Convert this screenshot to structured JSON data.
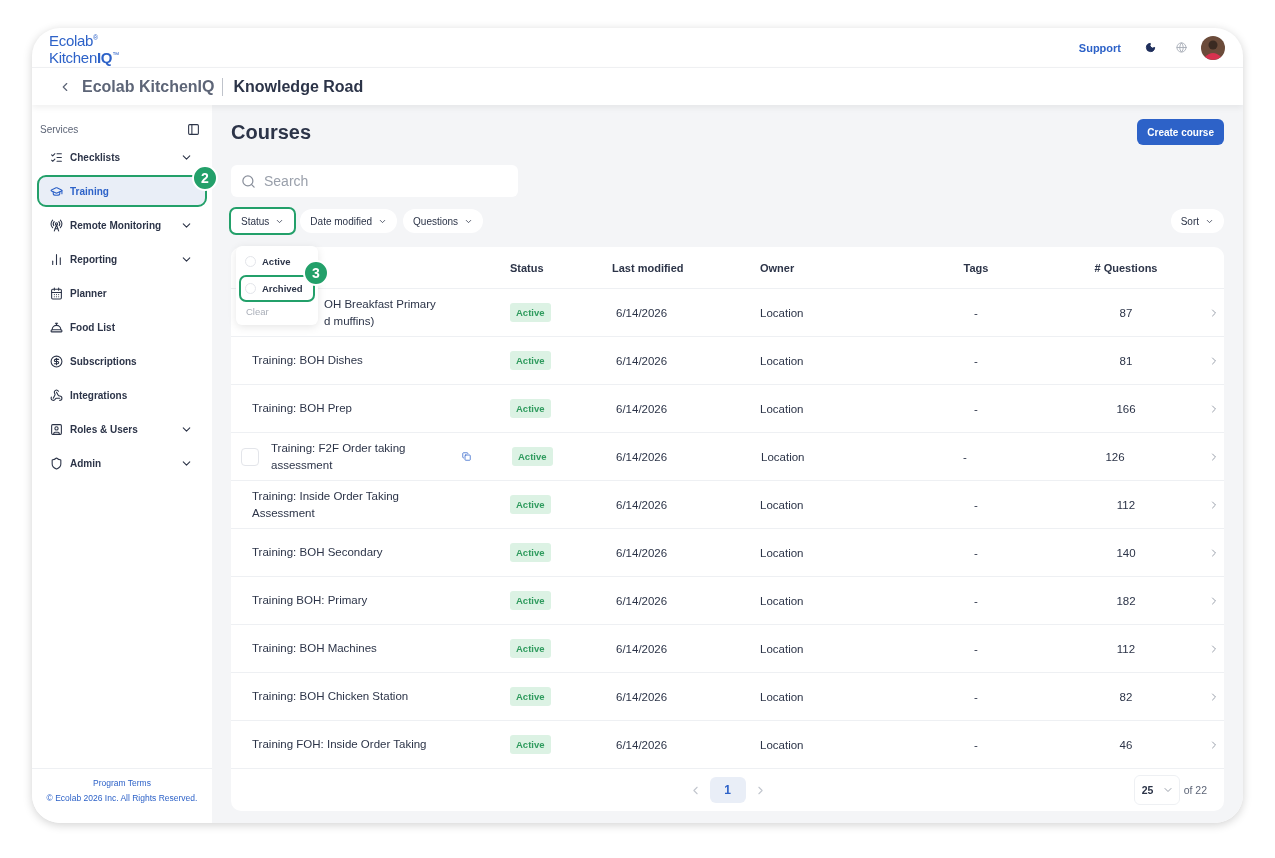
{
  "header": {
    "logo_line_1": "Ecolab$^{®}$",
    "logo_line_2": "Kitchen**IQ**$^{™}$",
    "support_link": "Support"
  },
  "breadcrumb": {
    "parent": "Ecolab KitchenIQ",
    "current": "Knowledge Road"
  },
  "sidebar": {
    "section_label": "Services",
    "items": [
      {
        "label": "Checklists",
        "expandable": true,
        "selected": false,
        "highlighted": false
      },
      {
        "label": "Training",
        "expandable": false,
        "selected": true,
        "highlighted": true,
        "callout": "2"
      },
      {
        "label": "Remote Monitoring",
        "expandable": true,
        "selected": false,
        "highlighted": false
      },
      {
        "label": "Reporting",
        "expandable": true,
        "selected": false,
        "highlighted": false
      },
      {
        "label": "Planner",
        "expandable": false,
        "selected": false,
        "highlighted": false
      },
      {
        "label": "Food List",
        "expandable": false,
        "selected": false,
        "highlighted": false
      },
      {
        "label": "Subscriptions",
        "expandable": false,
        "selected": false,
        "highlighted": false
      },
      {
        "label": "Integrations",
        "expandable": false,
        "selected": false,
        "highlighted": false
      },
      {
        "label": "Roles & Users",
        "expandable": true,
        "selected": false,
        "highlighted": false
      },
      {
        "label": "Admin",
        "expandable": true,
        "selected": false,
        "highlighted": false
      }
    ],
    "footer_link": "Program Terms",
    "copyright": "© Ecolab 2026 Inc. All Rights Reserved."
  },
  "page_title": "Courses",
  "create_button": "Create course",
  "search": {
    "placeholder": "Search"
  },
  "filters": [
    {
      "label": "Status",
      "highlighted": true
    },
    {
      "label": "Date modified",
      "highlighted": false
    },
    {
      "label": "Questions",
      "highlighted": false
    }
  ],
  "sort_button": "Sort",
  "status_menu": {
    "options": [
      {
        "label": "Active",
        "selected": false,
        "highlighted": false
      },
      {
        "label": "Archived",
        "selected": false,
        "highlighted": true,
        "callout": "3"
      }
    ],
    "clear": "Clear",
    "clear_disabled": true
  },
  "table": {
    "columns": [
      "Status",
      "Last modified",
      "Owner",
      "Tags",
      "# Questions"
    ],
    "rows": [
      {
        "kind": "partly_hidden",
        "name": "OH Breakfast Primary\nd muffins)",
        "status": "Active",
        "modified": "6/14/2026",
        "owner": "Location",
        "tags": "-",
        "questions": "87"
      },
      {
        "kind": "plain",
        "name": "Training: BOH Dishes",
        "status": "Active",
        "modified": "6/14/2026",
        "owner": "Location",
        "tags": "-",
        "questions": "81"
      },
      {
        "kind": "plain",
        "name": "Training:  BOH Prep",
        "status": "Active",
        "modified": "6/14/2026",
        "owner": "Location",
        "tags": "-",
        "questions": "166"
      },
      {
        "kind": "hover",
        "checked": false,
        "name": "Training: F2F Order taking\nassessment",
        "status": "Active",
        "modified": "6/14/2026",
        "owner": "Location",
        "tags": "-",
        "questions": "126"
      },
      {
        "kind": "plain",
        "name": "Training: Inside Order Taking\nAssessment",
        "status": "Active",
        "modified": "6/14/2026",
        "owner": "Location",
        "tags": "-",
        "questions": "112"
      },
      {
        "kind": "plain",
        "name": "Training: BOH Secondary",
        "status": "Active",
        "modified": "6/14/2026",
        "owner": "Location",
        "tags": "-",
        "questions": "140"
      },
      {
        "kind": "plain",
        "name": "Training BOH: Primary",
        "status": "Active",
        "modified": "6/14/2026",
        "owner": "Location",
        "tags": "-",
        "questions": "182"
      },
      {
        "kind": "plain",
        "name": "Training: BOH Machines",
        "status": "Active",
        "modified": "6/14/2026",
        "owner": "Location",
        "tags": "-",
        "questions": "112"
      },
      {
        "kind": "plain",
        "name": "Training: BOH Chicken Station",
        "status": "Active",
        "modified": "6/14/2026",
        "owner": "Location",
        "tags": "-",
        "questions": "82"
      },
      {
        "kind": "plain",
        "name": "Training FOH: Inside Order Taking",
        "status": "Active",
        "modified": "6/14/2026",
        "owner": "Location",
        "tags": "-",
        "questions": "46"
      }
    ]
  },
  "pagination": {
    "pages": [
      {
        "label": "1",
        "selected": true
      }
    ],
    "page_size": "25",
    "total": "of 22"
  }
}
